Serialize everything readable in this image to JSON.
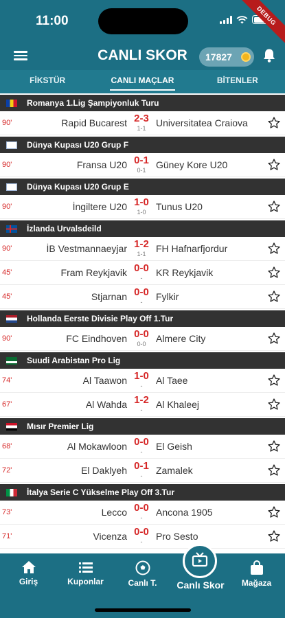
{
  "status": {
    "time": "11:00",
    "debug_label": "DEBUG"
  },
  "header": {
    "title": "CANLI SKOR",
    "coins": "17827"
  },
  "tabs": [
    {
      "label": "FİKSTÜR"
    },
    {
      "label": "CANLI MAÇLAR"
    },
    {
      "label": "BİTENLER"
    }
  ],
  "leagues": [
    {
      "name": "Romanya 1.Lig Şampiyonluk Turu",
      "matches": [
        {
          "minute": "90'",
          "home": "Rapid Bucarest",
          "score": "2-3",
          "ht": "1-1",
          "away": "Universitatea Craiova"
        }
      ]
    },
    {
      "name": "Dünya Kupası U20 Grup F",
      "matches": [
        {
          "minute": "90'",
          "home": "Fransa U20",
          "score": "0-1",
          "ht": "0-1",
          "away": "Güney Kore U20"
        }
      ]
    },
    {
      "name": "Dünya Kupası U20 Grup E",
      "matches": [
        {
          "minute": "90'",
          "home": "İngiltere U20",
          "score": "1-0",
          "ht": "1-0",
          "away": "Tunus U20"
        }
      ]
    },
    {
      "name": "İzlanda Urvalsdeild",
      "matches": [
        {
          "minute": "90'",
          "home": "İB Vestmannaeyjar",
          "score": "1-2",
          "ht": "1-1",
          "away": "FH Hafnarfjordur"
        },
        {
          "minute": "45'",
          "home": "Fram Reykjavik",
          "score": "0-0",
          "ht": "-",
          "away": "KR Reykjavik"
        },
        {
          "minute": "45'",
          "home": "Stjarnan",
          "score": "0-0",
          "ht": "-",
          "away": "Fylkir"
        }
      ]
    },
    {
      "name": "Hollanda Eerste Divisie Play Off 1.Tur",
      "matches": [
        {
          "minute": "90'",
          "home": "FC Eindhoven",
          "score": "0-0",
          "ht": "0-0",
          "away": "Almere City"
        }
      ]
    },
    {
      "name": "Suudi Arabistan Pro Lig",
      "matches": [
        {
          "minute": "74'",
          "home": "Al Taawon",
          "score": "1-0",
          "ht": "-",
          "away": "Al Taee"
        },
        {
          "minute": "67'",
          "home": "Al Wahda",
          "score": "1-2",
          "ht": "-",
          "away": "Al Khaleej"
        }
      ]
    },
    {
      "name": "Mısır Premier Lig",
      "matches": [
        {
          "minute": "68'",
          "home": "Al Mokawloon",
          "score": "0-0",
          "ht": "-",
          "away": "El Geish"
        },
        {
          "minute": "72'",
          "home": "El Daklyeh",
          "score": "0-1",
          "ht": "-",
          "away": "Zamalek"
        }
      ]
    },
    {
      "name": "İtalya Serie C Yükselme Play Off 3.Tur",
      "matches": [
        {
          "minute": "73'",
          "home": "Lecco",
          "score": "0-0",
          "ht": "-",
          "away": "Ancona 1905"
        },
        {
          "minute": "71'",
          "home": "Vicenza",
          "score": "0-0",
          "ht": "-",
          "away": "Pro Sesto"
        }
      ]
    }
  ],
  "nav": {
    "giris": "Giriş",
    "kuponlar": "Kuponlar",
    "canli_t": "Canlı T.",
    "canli_skor": "Canlı Skor",
    "magaza": "Mağaza"
  },
  "colors": {
    "primary": "#1c6f84",
    "league_bar": "#323232",
    "live_red": "#d62828"
  }
}
